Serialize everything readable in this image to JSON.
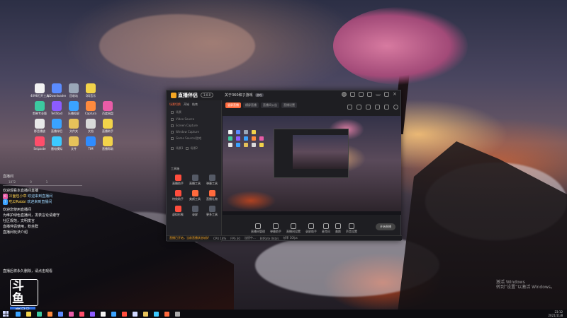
{
  "desktop": {
    "icons": [
      {
        "label": "4096打开工具",
        "color": "#f2f2f2"
      },
      {
        "label": "uDownloader",
        "color": "#5b8cff"
      },
      {
        "label": "回收站",
        "color": "#9aa7b8"
      },
      {
        "label": "QQ音乐",
        "color": "#f2d34a"
      },
      {
        "label": "",
        "color": "rgba(0,0,0,0)"
      },
      {
        "label": "剪映专业版",
        "color": "#3cc9a0"
      },
      {
        "label": "TeXStud",
        "color": "#8c5cff"
      },
      {
        "label": "乐播投屏",
        "color": "#3aa3ff"
      },
      {
        "label": "Captura",
        "color": "#ff8a3d"
      },
      {
        "label": "百度网盘",
        "color": "#e85ca7"
      },
      {
        "label": "影音播放",
        "color": "#e8e8e8"
      },
      {
        "label": "直播伴侣",
        "color": "#3aa3ff"
      },
      {
        "label": "文件夹",
        "color": "#e6c25a"
      },
      {
        "label": "文档",
        "color": "#d9d9d9"
      },
      {
        "label": "直播助手",
        "color": "#f2d34a"
      },
      {
        "label": "Snipaste",
        "color": "#ff4d6a"
      },
      {
        "label": "雷电模拟",
        "color": "#3cc9ff"
      },
      {
        "label": "文件",
        "color": "#e6c25a"
      },
      {
        "label": "TIM",
        "color": "#2f8cff"
      },
      {
        "label": "直播帮助",
        "color": "#f2d34a"
      }
    ]
  },
  "chat": {
    "handle": "直播间",
    "stats": [
      "1872",
      "0",
      "1"
    ],
    "messages": [
      {
        "text": "欢迎观看本直播间直播"
      },
      {
        "badge": "6",
        "badge_color": "#e85ca7",
        "name": "冷面包小草",
        "note": "欢迎来到直播间"
      },
      {
        "badge": "7",
        "badge_color": "#3aa3ff",
        "name": "吃瓜Rabbi",
        "note": "欢迎来到直播间"
      },
      {
        "text": "欢迎您使用直播间"
      },
      {
        "text": "为维护绿色直播间，发表言论请遵守"
      },
      {
        "text": "社区规范，文明发言"
      },
      {
        "text": "直播伴侣使用，粉丝群"
      },
      {
        "text": "直播间玩法介绍"
      }
    ],
    "bottom": "直播后将永久删除，请点击观看"
  },
  "logo": {
    "big": "斗鱼",
    "sub": "房间号",
    "number": "9879678"
  },
  "app": {
    "brand": "直播伴侣",
    "version": "3.0.0",
    "room": "关于360和子游戏",
    "room_tag": "游戏",
    "side_tabs": [
      "场景切换",
      "开始",
      "结束"
    ],
    "scenes": [
      "场景",
      "Video Source",
      "Screen Capture",
      "Window Capture",
      "Game Source/游戏"
    ],
    "scene_footer": [
      "场景1",
      "场景2"
    ],
    "tools_title": "工具箱",
    "tools": [
      {
        "label": "直播助手",
        "color": "#ff4d3d"
      },
      {
        "label": "直播工具",
        "color": "#555a66"
      },
      {
        "label": "弹幕工具",
        "color": "#555a66"
      },
      {
        "label": "特效助手",
        "color": "#ff4d3d"
      },
      {
        "label": "美颜工具",
        "color": "#ff6a3d"
      },
      {
        "label": "直播礼物",
        "color": "#ff6a3d"
      },
      {
        "label": "虚拟形象",
        "color": "#ff4d3d"
      },
      {
        "label": "录屏",
        "color": "#555a66"
      },
      {
        "label": "更多工具",
        "color": "#555a66"
      }
    ],
    "sub_tabs": [
      "竖屏直播",
      "横屏直播",
      "直播间公告",
      "直播设置"
    ],
    "controls": [
      "直播间管理",
      "弹幕助手",
      "直播间设置",
      "录屏助手",
      "麦克风",
      "美颜",
      "声音设置"
    ],
    "start_label": "开始直播",
    "status": [
      "CPU 18%",
      "FPS 30",
      "连接中...",
      "BitRate 0kb/s",
      "帧率 30fps"
    ],
    "status_warn": "直播已开始，当前直播状态较好"
  },
  "watermark": {
    "line1": "激活 Windows",
    "line2": "转到“设置”以激活 Windows。"
  },
  "taskbar": {
    "app_colors": [
      "#3aa3ff",
      "#f2d34a",
      "#3cc9a0",
      "#ff8a3d",
      "#5b8cff",
      "#e85ca7",
      "#ff4d6a",
      "#8c5cff",
      "#f2f2f2",
      "#3aa3ff",
      "#ff4d3d",
      "#cfd8ff",
      "#e6c25a",
      "#3cc9ff",
      "#ff6a3d",
      "#aaaaaa"
    ],
    "time": "23:12",
    "date": "2021/11/8"
  }
}
